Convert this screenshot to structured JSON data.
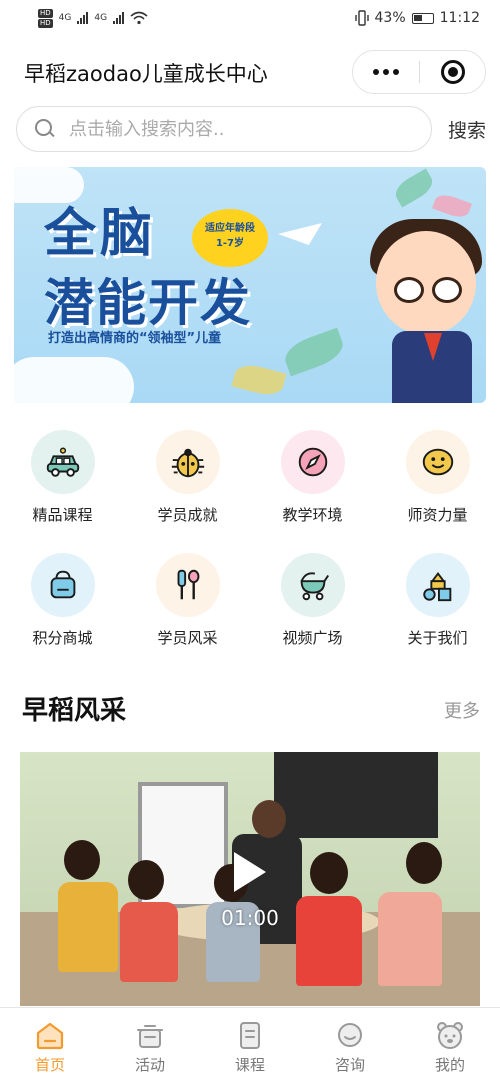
{
  "status_bar": {
    "hd1": "HD",
    "hd2": "HD",
    "signal_label_1": "4G",
    "signal_label_2": "4G",
    "battery": "43%",
    "time": "11:12"
  },
  "title_bar": {
    "title": "早稻zaodao儿童成长中心"
  },
  "search": {
    "placeholder": "点击输入搜索内容..",
    "button_label": "搜索"
  },
  "banner": {
    "line1": "全脑",
    "line2": "潜能开发",
    "badge_line1": "适应年龄段",
    "badge_line2": "1-7岁",
    "subtitle": "打造出高情商的“领袖型”儿童"
  },
  "menu": {
    "items": [
      {
        "label": "精品课程",
        "icon": "car-icon",
        "bg": "#e3f1ef"
      },
      {
        "label": "学员成就",
        "icon": "ladybug-icon",
        "bg": "#fdf3e6"
      },
      {
        "label": "教学环境",
        "icon": "compass-icon",
        "bg": "#fde8f0"
      },
      {
        "label": "师资力量",
        "icon": "smiley-icon",
        "bg": "#fdf3e6"
      },
      {
        "label": "积分商城",
        "icon": "basket-icon",
        "bg": "#e2f2fa"
      },
      {
        "label": "学员风采",
        "icon": "utensils-icon",
        "bg": "#fdf3e6"
      },
      {
        "label": "视频广场",
        "icon": "stroller-icon",
        "bg": "#e3f1ef"
      },
      {
        "label": "关于我们",
        "icon": "blocks-icon",
        "bg": "#e2f2fa"
      }
    ]
  },
  "section": {
    "title": "早稻风采",
    "more": "更多"
  },
  "video": {
    "duration": "01:00"
  },
  "tab_bar": {
    "tabs": [
      {
        "label": "首页",
        "icon": "home-icon",
        "active": true
      },
      {
        "label": "活动",
        "icon": "activity-icon",
        "active": false
      },
      {
        "label": "课程",
        "icon": "course-icon",
        "active": false
      },
      {
        "label": "咨询",
        "icon": "chat-icon",
        "active": false
      },
      {
        "label": "我的",
        "icon": "profile-icon",
        "active": false
      }
    ]
  },
  "colors": {
    "accent": "#f29a2e",
    "banner_text": "#1a4f9c",
    "icon_stroke": "#1a1a1a"
  }
}
